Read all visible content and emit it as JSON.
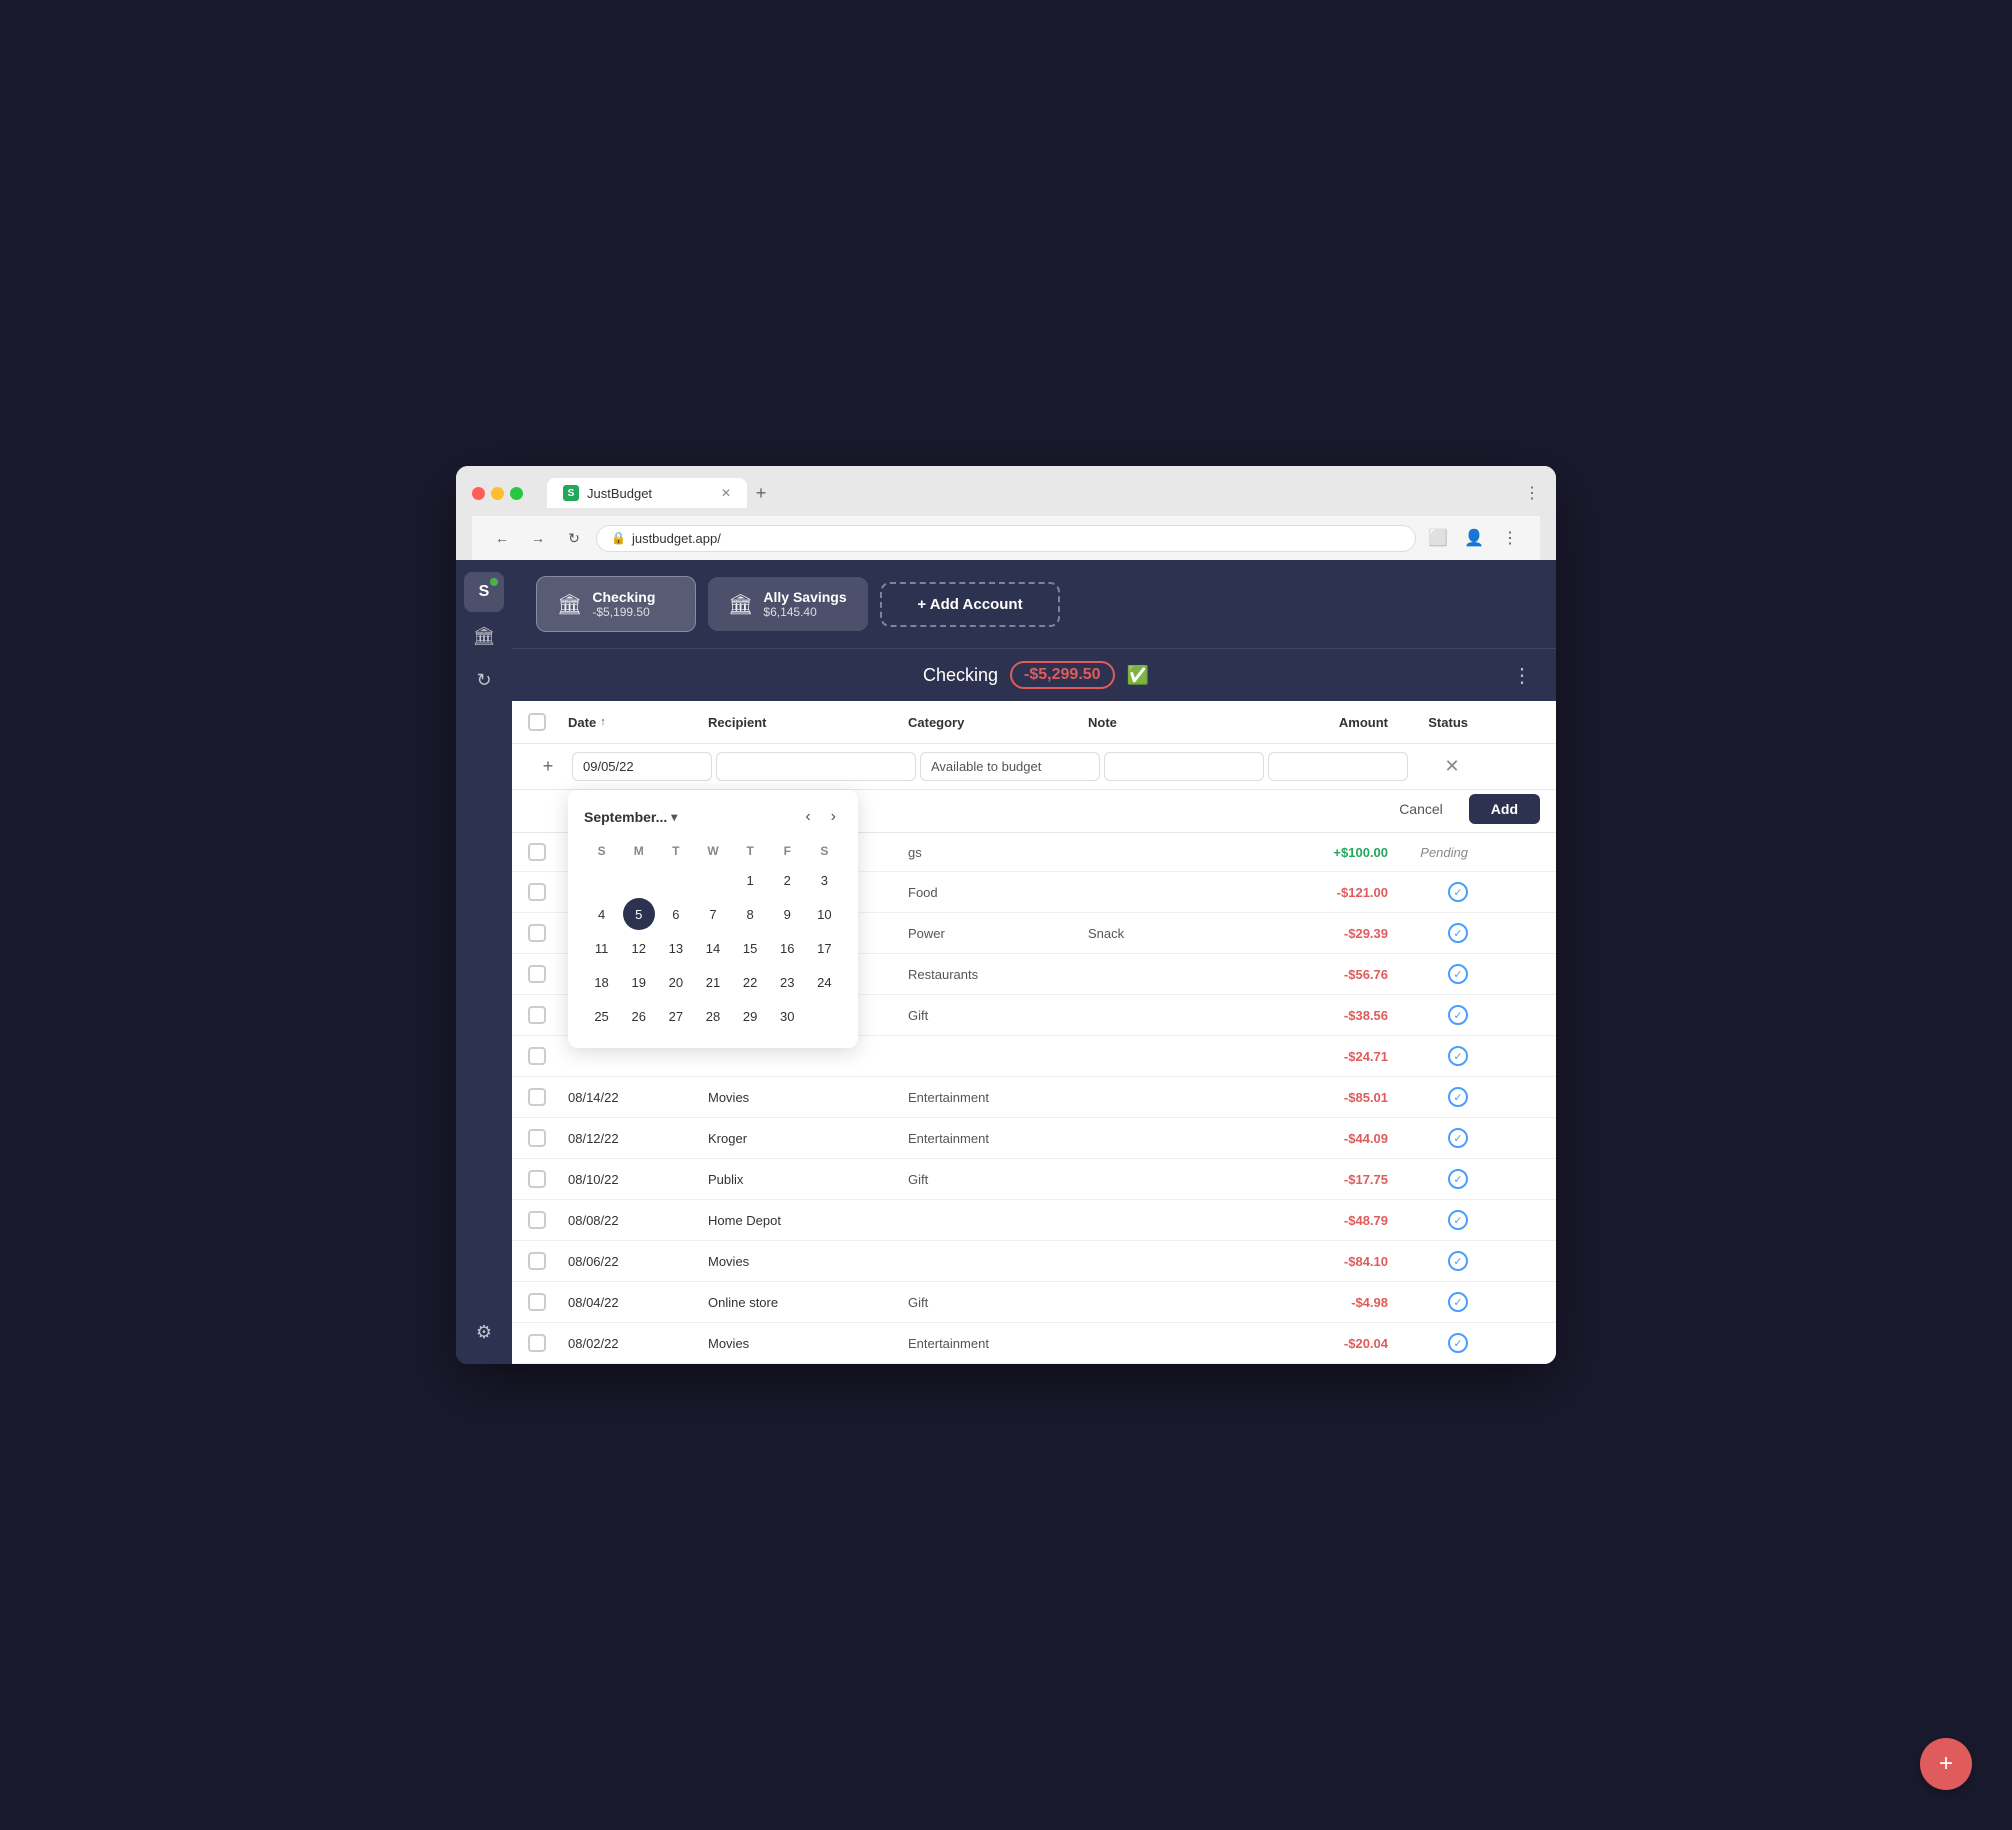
{
  "browser": {
    "tab_title": "JustBudget",
    "tab_icon": "S",
    "address": "justbudget.app/",
    "nav_back": "←",
    "nav_forward": "→",
    "nav_refresh": "↻",
    "more_menu": "⋮"
  },
  "accounts": [
    {
      "name": "Checking",
      "balance": "-$5,199.50",
      "active": true
    },
    {
      "name": "Ally Savings",
      "balance": "$6,145.40",
      "active": false
    }
  ],
  "add_account_label": "+ Add Account",
  "page": {
    "title": "Checking",
    "balance": "-$5,299.50",
    "more": "⋮"
  },
  "table": {
    "headers": [
      "Date",
      "Recipient",
      "Category",
      "Note",
      "Amount",
      "Status"
    ],
    "date_sort": "↑"
  },
  "new_transaction": {
    "date_value": "09/05/22",
    "recipient_placeholder": "",
    "category_value": "Available to budget",
    "note_placeholder": "",
    "amount_placeholder": "",
    "cancel_label": "Cancel",
    "add_label": "Add"
  },
  "calendar": {
    "month_label": "September...",
    "chevron": "▾",
    "prev": "‹",
    "next": "›",
    "day_headers": [
      "S",
      "M",
      "T",
      "W",
      "T",
      "F",
      "S"
    ],
    "weeks": [
      [
        "",
        "",
        "",
        "",
        "1",
        "2",
        "3"
      ],
      [
        "4",
        "5",
        "6",
        "7",
        "8",
        "9",
        "10"
      ],
      [
        "11",
        "12",
        "13",
        "14",
        "15",
        "16",
        "17"
      ],
      [
        "18",
        "19",
        "20",
        "21",
        "22",
        "23",
        "24"
      ],
      [
        "25",
        "26",
        "27",
        "28",
        "29",
        "30",
        ""
      ]
    ],
    "selected_day": "5"
  },
  "transactions": [
    {
      "date": "",
      "recipient": "",
      "category": "gs",
      "note": "",
      "amount": "+$100.00",
      "amount_type": "positive",
      "status": "Pending",
      "status_type": "pending"
    },
    {
      "date": "",
      "recipient": "",
      "category": "Food",
      "note": "",
      "amount": "-$121.00",
      "amount_type": "negative",
      "status": "✓",
      "status_type": "checked"
    },
    {
      "date": "",
      "recipient": "",
      "category": "Power",
      "note": "Snack",
      "amount": "-$29.39",
      "amount_type": "negative",
      "status": "✓",
      "status_type": "checked"
    },
    {
      "date": "",
      "recipient": "",
      "category": "Restaurants",
      "note": "",
      "amount": "-$56.76",
      "amount_type": "negative",
      "status": "✓",
      "status_type": "checked"
    },
    {
      "date": "",
      "recipient": "",
      "category": "Gift",
      "note": "",
      "amount": "-$38.56",
      "amount_type": "negative",
      "status": "✓",
      "status_type": "checked"
    },
    {
      "date": "",
      "recipient": "",
      "category": "",
      "note": "",
      "amount": "-$24.71",
      "amount_type": "negative",
      "status": "✓",
      "status_type": "checked"
    },
    {
      "date": "08/14/22",
      "recipient": "Movies",
      "category": "Entertainment",
      "note": "",
      "amount": "-$85.01",
      "amount_type": "negative",
      "status": "✓",
      "status_type": "checked"
    },
    {
      "date": "08/12/22",
      "recipient": "Kroger",
      "category": "Entertainment",
      "note": "",
      "amount": "-$44.09",
      "amount_type": "negative",
      "status": "✓",
      "status_type": "checked"
    },
    {
      "date": "08/10/22",
      "recipient": "Publix",
      "category": "Gift",
      "note": "",
      "amount": "-$17.75",
      "amount_type": "negative",
      "status": "✓",
      "status_type": "checked"
    },
    {
      "date": "08/08/22",
      "recipient": "Home Depot",
      "category": "",
      "note": "",
      "amount": "-$48.79",
      "amount_type": "negative",
      "status": "✓",
      "status_type": "checked"
    },
    {
      "date": "08/06/22",
      "recipient": "Movies",
      "category": "",
      "note": "",
      "amount": "-$84.10",
      "amount_type": "negative",
      "status": "✓",
      "status_type": "checked"
    },
    {
      "date": "08/04/22",
      "recipient": "Online store",
      "category": "Gift",
      "note": "",
      "amount": "-$4.98",
      "amount_type": "negative",
      "status": "✓",
      "status_type": "checked"
    },
    {
      "date": "08/02/22",
      "recipient": "Movies",
      "category": "Entertainment",
      "note": "",
      "amount": "-$20.04",
      "amount_type": "negative",
      "status": "✓",
      "status_type": "checked"
    }
  ],
  "sidebar": {
    "icons": [
      {
        "name": "logo-icon",
        "symbol": "S",
        "badge": true
      },
      {
        "name": "wallet-icon",
        "symbol": "🏛"
      },
      {
        "name": "refresh-icon",
        "symbol": "↻"
      }
    ],
    "bottom_icons": [
      {
        "name": "settings-icon",
        "symbol": "⚙"
      }
    ]
  },
  "fab_label": "+"
}
